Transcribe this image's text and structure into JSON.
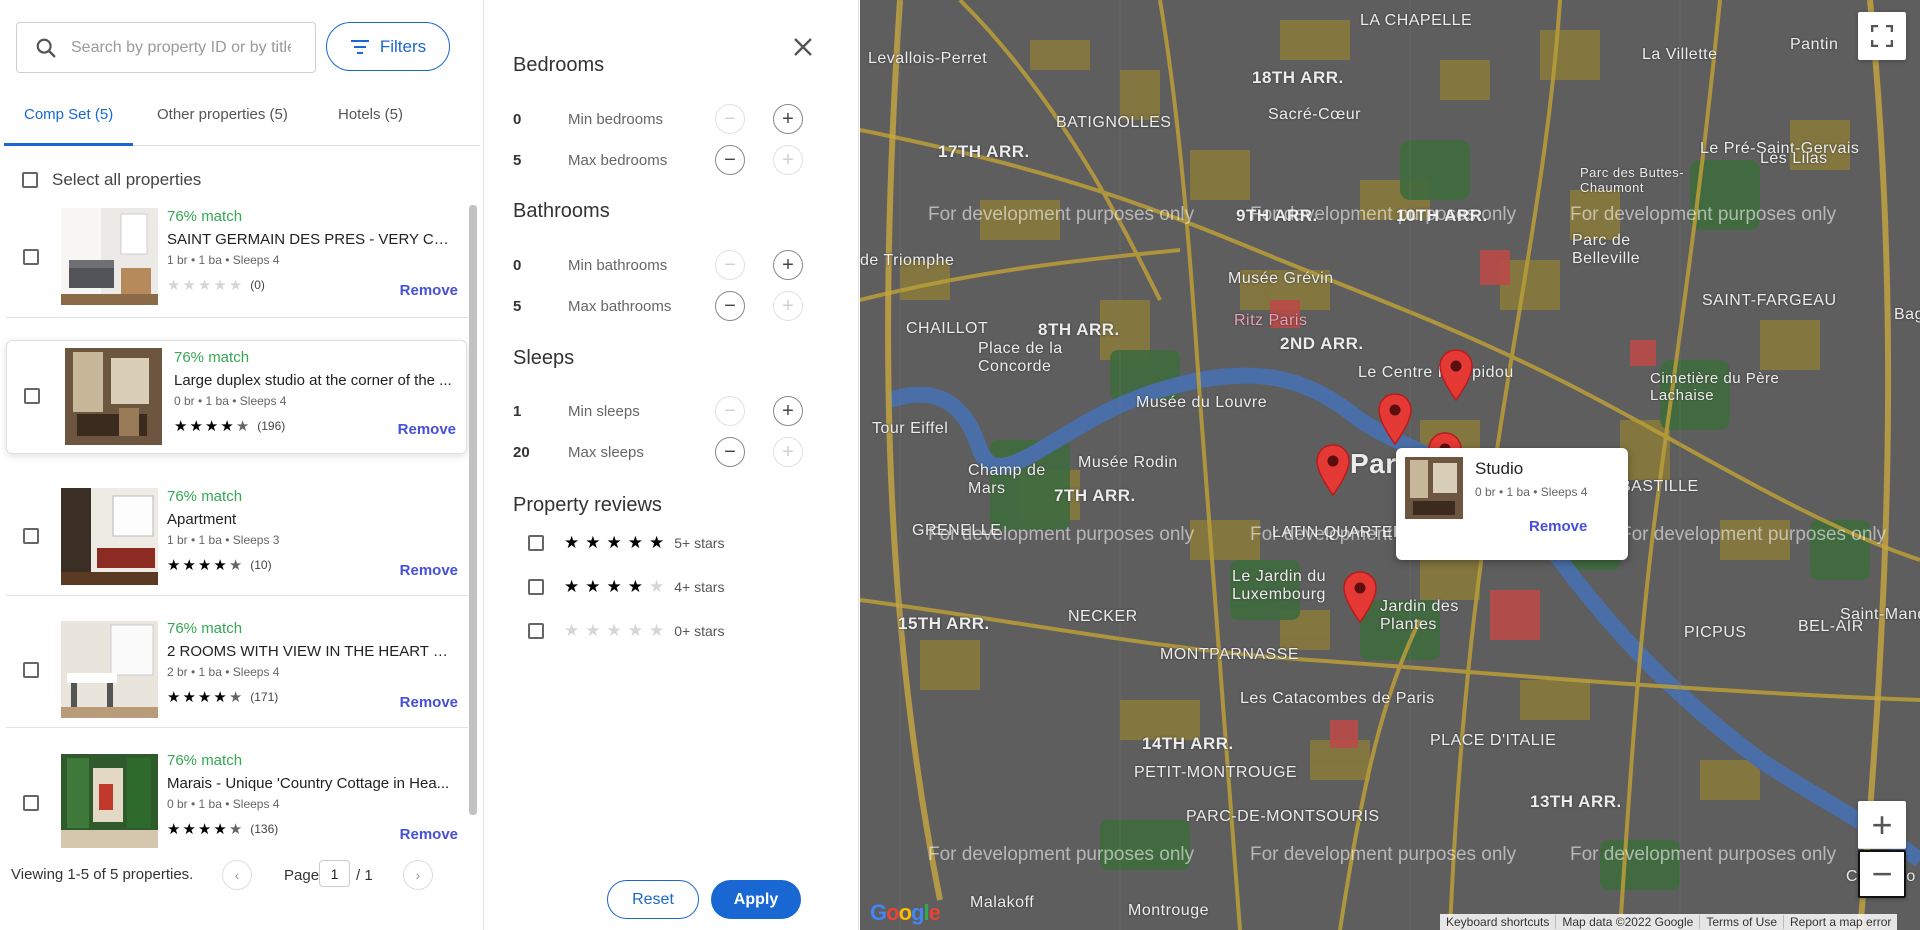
{
  "search": {
    "placeholder": "Search by property ID or by title"
  },
  "filters_button": {
    "label": "Filters"
  },
  "tabs": [
    {
      "label": "Comp Set (5)",
      "active": true
    },
    {
      "label": "Other properties (5)",
      "active": false
    },
    {
      "label": "Hotels (5)",
      "active": false
    }
  ],
  "select_all_label": "Select all properties",
  "properties": [
    {
      "match": "76% match",
      "title": "SAINT GERMAIN DES PRES - VERY CEN...",
      "meta": "1 br • 1 ba • Sleeps 4",
      "rating": 0,
      "reviews": "(0)",
      "remove": "Remove"
    },
    {
      "match": "76% match",
      "title": "Large duplex studio at the corner of the ...",
      "meta": "0 br • 1 ba • Sleeps 4",
      "rating": 4.5,
      "reviews": "(196)",
      "remove": "Remove"
    },
    {
      "match": "76% match",
      "title": "Apartment",
      "meta": "1 br • 1 ba • Sleeps 3",
      "rating": 4.5,
      "reviews": "(10)",
      "remove": "Remove"
    },
    {
      "match": "76% match",
      "title": "2 ROOMS WITH VIEW IN THE HEART OF...",
      "meta": "2 br • 1 ba • Sleeps 4",
      "rating": 4.5,
      "reviews": "(171)",
      "remove": "Remove"
    },
    {
      "match": "76% match",
      "title": "Marais - Unique 'Country Cottage in Hea...",
      "meta": "0 br • 1 ba • Sleeps 4",
      "rating": 4.5,
      "reviews": "(136)",
      "remove": "Remove"
    }
  ],
  "pagination": {
    "viewing": "Viewing 1-5 of 5 properties.",
    "page_label": "Page",
    "page": "1",
    "of": "/ 1"
  },
  "filter_panel": {
    "bedrooms": {
      "title": "Bedrooms",
      "min_value": "0",
      "min_label": "Min bedrooms",
      "max_value": "5",
      "max_label": "Max bedrooms"
    },
    "bathrooms": {
      "title": "Bathrooms",
      "min_value": "0",
      "min_label": "Min bathrooms",
      "max_value": "5",
      "max_label": "Max bathrooms"
    },
    "sleeps": {
      "title": "Sleeps",
      "min_value": "1",
      "min_label": "Min sleeps",
      "max_value": "20",
      "max_label": "Max sleeps"
    },
    "reviews": {
      "title": "Property reviews",
      "options": [
        {
          "stars": 5,
          "label": "5+ stars"
        },
        {
          "stars": 4,
          "label": "4+ stars"
        },
        {
          "stars": 0,
          "label": "0+ stars"
        }
      ]
    },
    "reset_label": "Reset",
    "apply_label": "Apply"
  },
  "map": {
    "labels": {
      "la_chapelle": "LA CHAPELLE",
      "levallois": "Levallois-Perret",
      "arr18": "18TH ARR.",
      "la_villette": "La Villette",
      "pantin": "Pantin",
      "batignolles": "BATIGNOLLES",
      "sacre_coeur": "Sacré-Cœur",
      "arr17": "17TH ARR.",
      "pre_st_gervais": "Le Pré-Saint-Gervais",
      "buttes": "Parc des Buttes-Chaumont",
      "lilas": "Les Lilas",
      "belleville": "Parc de Belleville",
      "triomphe": "de Triomphe",
      "musee_grevin": "Musée Grévin",
      "st_fargeau": "SAINT-FARGEAU",
      "chaillot": "CHAILLOT",
      "arr8": "8TH ARR.",
      "ritz": "Ritz Paris",
      "arr2": "2ND ARR.",
      "bagnolet": "Bagno",
      "concorde": "Place de la Concorde",
      "centre_pompidou": "Le Centre Pompidou",
      "pere_lachaise": "Cimetière du Père Lachaise",
      "tour_eiffel": "Tour Eiffel",
      "louvre": "Musée du Louvre",
      "champ_mars": "Champ de Mars",
      "rodin": "Musée Rodin",
      "paris": "Par",
      "arr7": "7TH ARR.",
      "bastille": "BASTILLE",
      "latin_quarter": "LATIN QUARTER",
      "grenelle": "GRENELLE",
      "luxembourg": "Le Jardin du Luxembourg",
      "jardin_plantes": "Jardin des Plantes",
      "necker": "NECKER",
      "arr15": "15TH ARR.",
      "picpus": "PICPUS",
      "bel_air": "BEL-AIR",
      "st_mande": "Saint-Mandé",
      "montparnasse": "MONTPARNASSE",
      "catacombes": "Les Catacombes de Paris",
      "arr14": "14TH ARR.",
      "place_italie": "PLACE D'ITALIE",
      "petit_montrouge": "PETIT-MONTROUGE",
      "arr13": "13TH ARR.",
      "parc_montsouris": "PARC-DE-MONTSOURIS",
      "malakoff": "Malakoff",
      "montrouge": "Montrouge",
      "charenton": "Charento",
      "arr9": "9TH ARR.",
      "arr10": "10TH ARR."
    },
    "watermark": "For development purposes only",
    "popup": {
      "title": "Studio",
      "meta": "0 br • 1 ba • Sleeps 4",
      "remove": "Remove"
    },
    "attribution": {
      "shortcuts": "Keyboard shortcuts",
      "data": "Map data ©2022 Google",
      "terms": "Terms of Use",
      "report": "Report a map error"
    },
    "logo": "Google",
    "zoom_in": "+",
    "zoom_out": "−",
    "accent": "#e53935"
  },
  "colors": {
    "primary": "#1967d2",
    "match": "#34a853",
    "remove": "#4650d8"
  }
}
